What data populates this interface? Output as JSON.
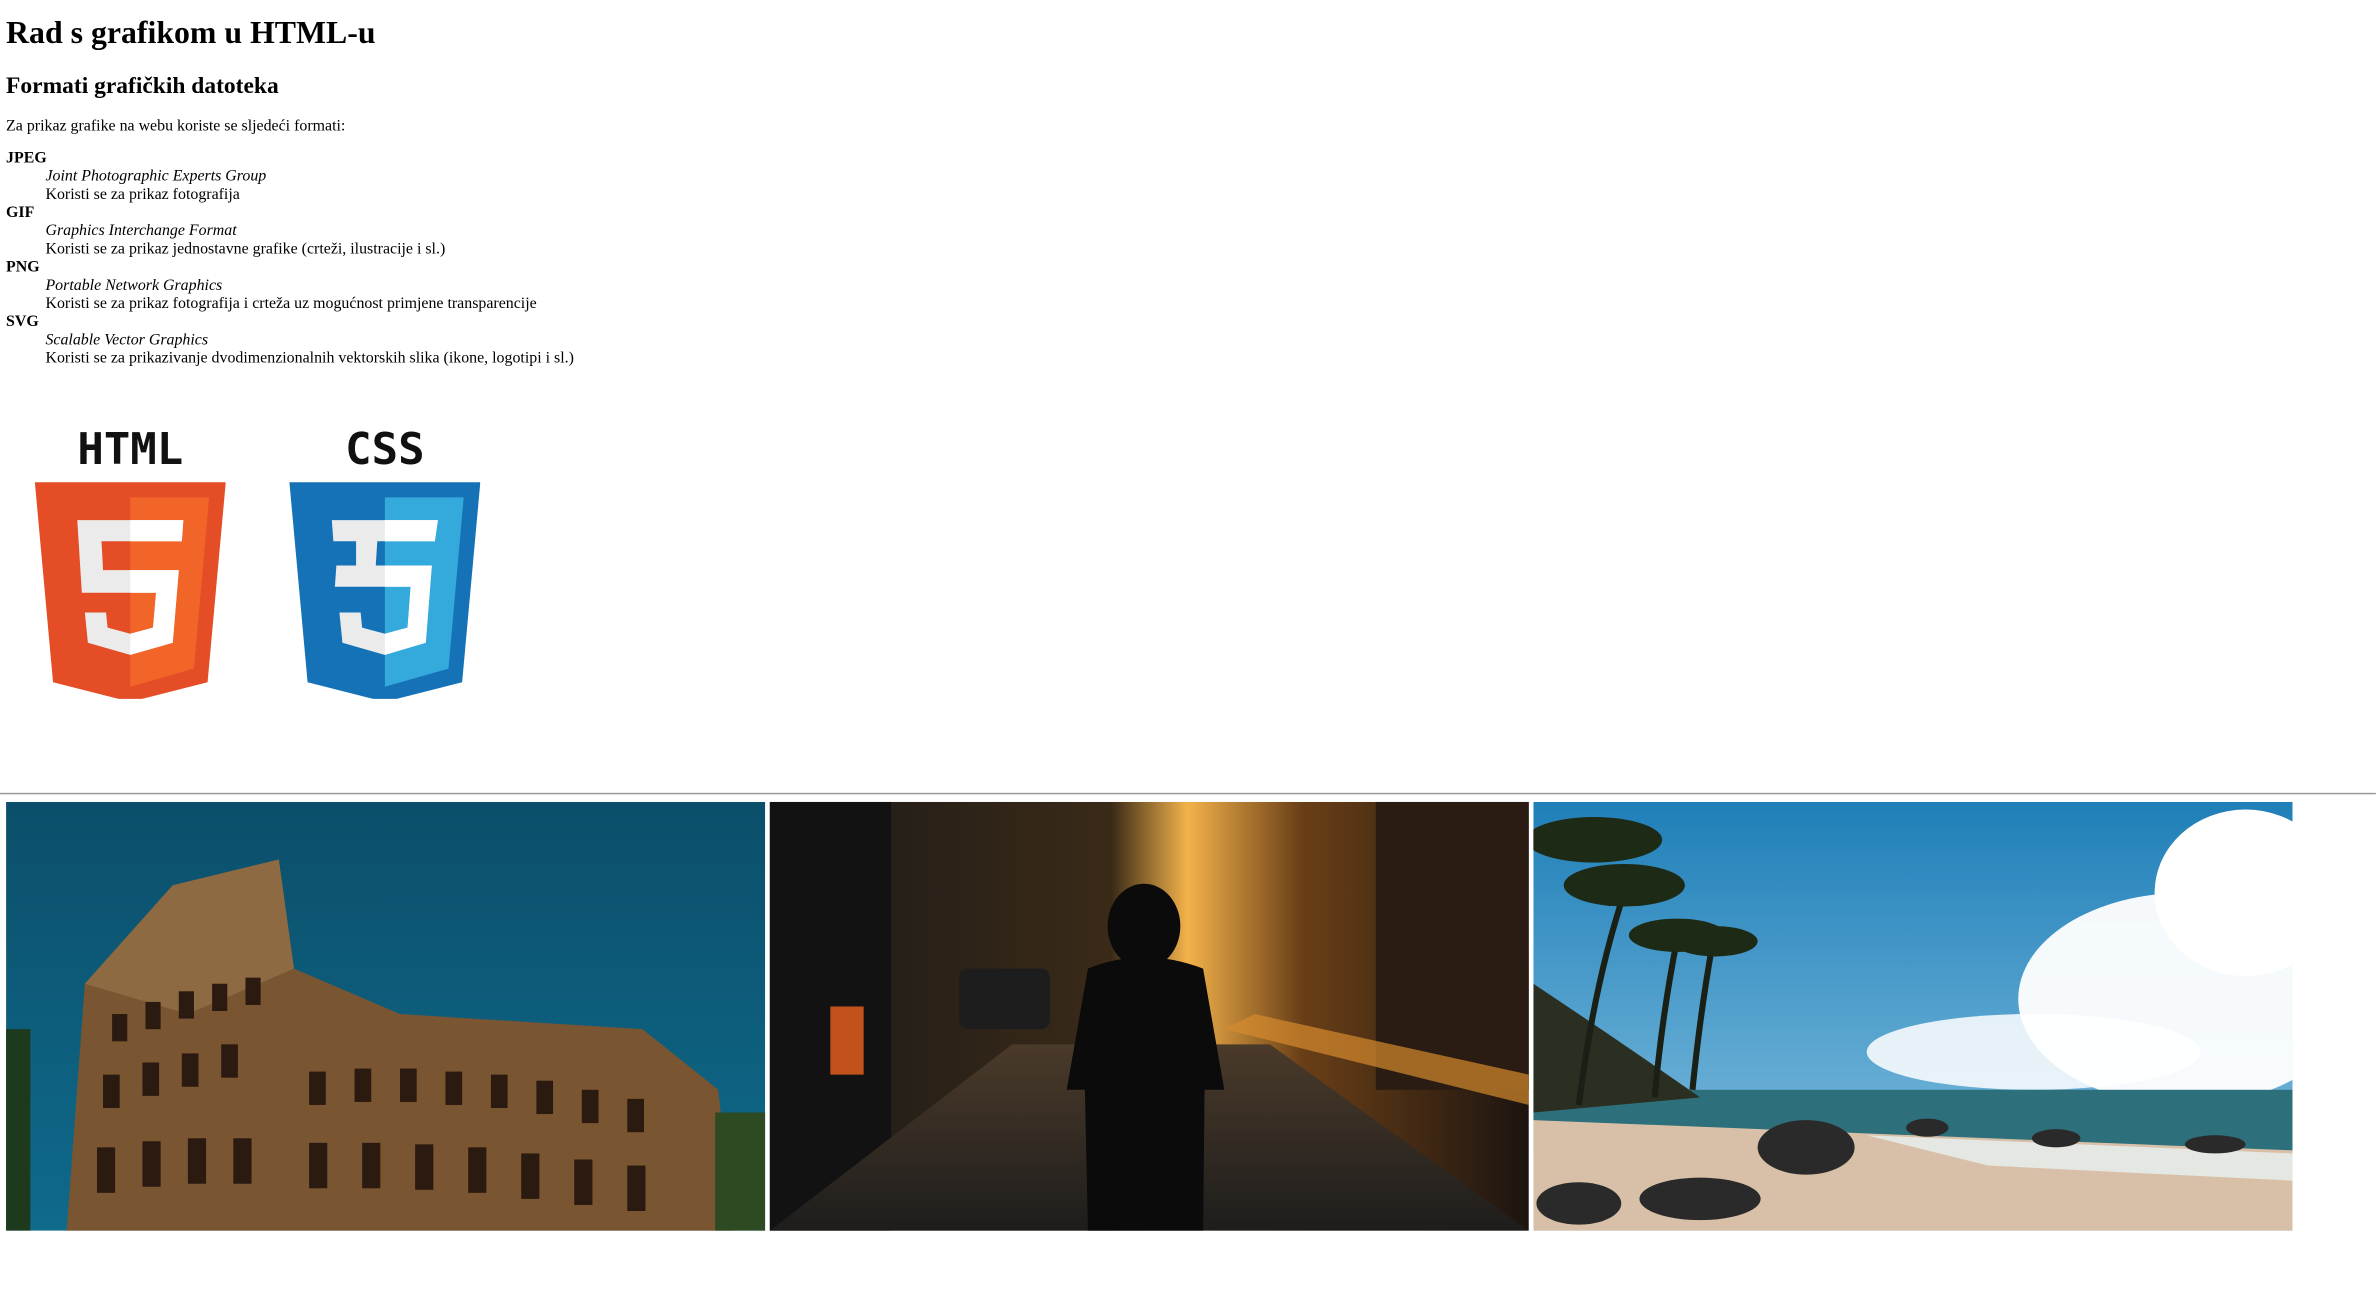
{
  "page": {
    "title": "Rad s grafikom u HTML-u",
    "subtitle": "Formati grafičkih datoteka",
    "intro": "Za prikaz grafike na webu koriste se sljedeći formati:"
  },
  "formats": [
    {
      "abbr": "JPEG",
      "full": "Joint Photographic Experts Group",
      "desc": "Koristi se za prikaz fotografija"
    },
    {
      "abbr": "GIF",
      "full": "Graphics Interchange Format",
      "desc": "Koristi se za prikaz jednostavne grafike (crteži, ilustracije i sl.)"
    },
    {
      "abbr": "PNG",
      "full": "Portable Network Graphics",
      "desc": "Koristi se za prikaz fotografija i crteža uz mogućnost primjene transparencije"
    },
    {
      "abbr": "SVG",
      "full": "Scalable Vector Graphics",
      "desc": "Koristi se za prikazivanje dvodimenzionalnih vektorskih slika (ikone, logotipi i sl.)"
    }
  ],
  "logos": {
    "html": {
      "word": "HTML",
      "number": "5",
      "color_main": "#e44d26",
      "color_light": "#f16529"
    },
    "css": {
      "word": "CSS",
      "number": "3",
      "color_main": "#1572b6",
      "color_light": "#33a9dc"
    }
  },
  "gallery": [
    {
      "subject": "colosseum-photo"
    },
    {
      "subject": "hooded-person-street-photo"
    },
    {
      "subject": "tropical-beach-photo"
    }
  ]
}
